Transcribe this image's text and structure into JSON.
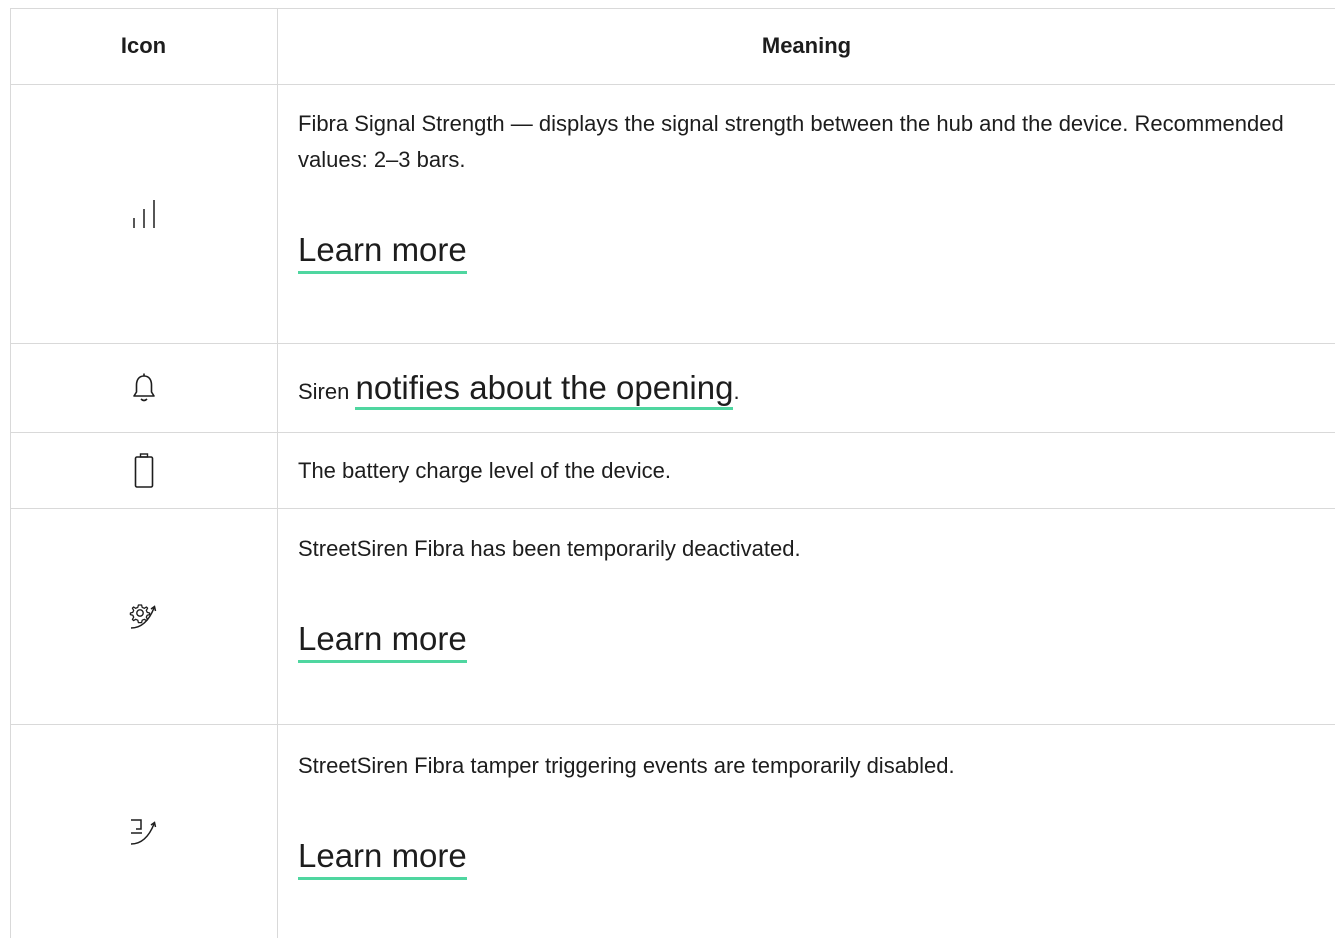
{
  "table": {
    "headers": {
      "icon": "Icon",
      "meaning": "Meaning"
    },
    "rows": [
      {
        "icon": "signal-strength-icon",
        "text": "Fibra Signal Strength — displays the signal strength between the hub and the device. Recommended values: 2–3 bars.",
        "link": "Learn more"
      },
      {
        "icon": "bell-icon",
        "text_before": "Siren",
        "link": "notifies about the opening",
        "text_after": "."
      },
      {
        "icon": "battery-icon",
        "text": "The battery charge level of the device."
      },
      {
        "icon": "gear-deactivated-icon",
        "text": "StreetSiren Fibra has been temporarily deactivated.",
        "link": "Learn more"
      },
      {
        "icon": "tamper-disabled-icon",
        "text": "StreetSiren Fibra tamper triggering events are temporarily disabled.",
        "link": "Learn more"
      }
    ]
  },
  "colors": {
    "border": "#d9d9d9",
    "link_underline": "#4fd6a0",
    "text": "#1d1d1d"
  }
}
